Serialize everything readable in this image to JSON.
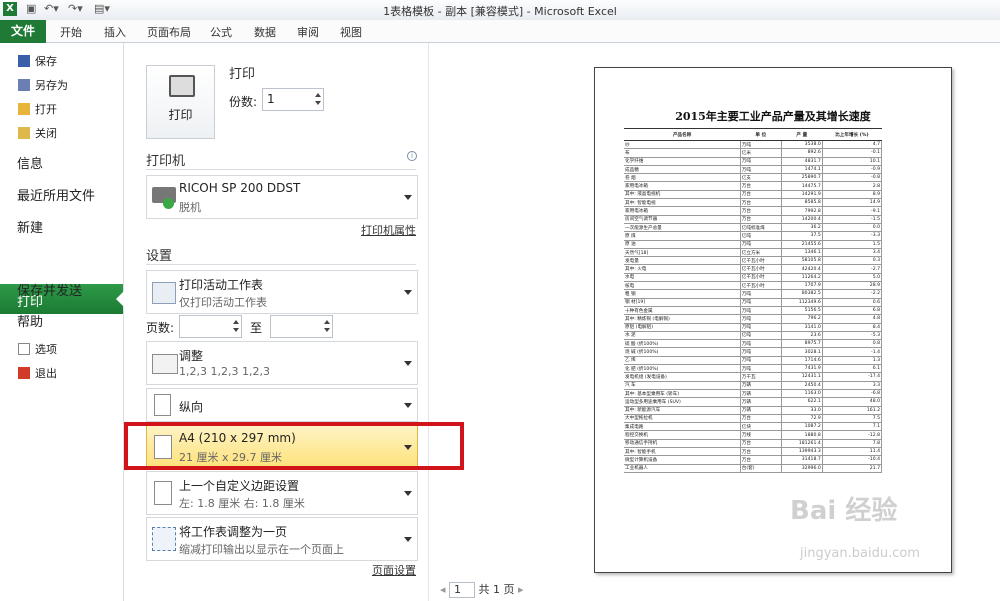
{
  "window": {
    "title": "1表格模板 - 副本  [兼容模式]  -  Microsoft Excel"
  },
  "ribbon": {
    "file_tab": "文件",
    "tabs": [
      "开始",
      "插入",
      "页面布局",
      "公式",
      "数据",
      "审阅",
      "视图"
    ]
  },
  "nav": {
    "save": "保存",
    "save_as": "另存为",
    "open": "打开",
    "close": "关闭",
    "info": "信息",
    "recent": "最近所用文件",
    "new": "新建",
    "print": "打印",
    "save_send": "保存并发送",
    "help": "帮助",
    "options": "选项",
    "exit": "退出"
  },
  "print": {
    "heading": "打印",
    "button_label": "打印",
    "copies_label": "份数:",
    "copies_value": "1"
  },
  "printer": {
    "heading": "打印机",
    "name": "RICOH SP 200 DDST",
    "status": "脱机",
    "properties_link": "打印机属性"
  },
  "settings": {
    "heading": "设置",
    "scope_title": "打印活动工作表",
    "scope_sub": "仅打印活动工作表",
    "pages_label": "页数:",
    "pages_to": "至",
    "collate_title": "调整",
    "collate_sub": "1,2,3    1,2,3    1,2,3",
    "orientation": "纵向",
    "paper_title": "A4 (210 x 297 mm)",
    "paper_sub": "21 厘米 x 29.7 厘米",
    "margins_title": "上一个自定义边距设置",
    "margins_sub": "左:  1.8 厘米    右:  1.8 厘米",
    "scaling_title": "将工作表调整为一页",
    "scaling_sub": "缩减打印输出以显示在一个页面上",
    "page_setup_link": "页面设置"
  },
  "preview": {
    "doc_title": "2015年主要工业产品产量及其增长速度",
    "headers": [
      "产品名称",
      "单 位",
      "产 量",
      "比上年增长 (%)"
    ],
    "rows": [
      [
        "纱",
        "万吨",
        "3538.0",
        "4.7"
      ],
      [
        "布",
        "亿米",
        "892.6",
        "-0.1"
      ],
      [
        "化学纤维",
        "万吨",
        "4831.7",
        "10.1"
      ],
      [
        "成品糖",
        "万吨",
        "1474.1",
        "-0.9"
      ],
      [
        "卷 烟",
        "亿支",
        "25890.7",
        "-0.8"
      ],
      [
        "家用电冰箱",
        "万台",
        "14475.7",
        "2.8"
      ],
      [
        "  其中: 液晶电视机",
        "万台",
        "14291.9",
        "8.9"
      ],
      [
        "其中: 智能电视",
        "万台",
        "8585.8",
        "14.9"
      ],
      [
        "家用电冰箱",
        "万台",
        "7992.8",
        "-9.1"
      ],
      [
        "房间空气调节器",
        "万台",
        "14200.4",
        "-1.5"
      ],
      [
        "一次能源生产总量",
        "亿吨标准煤",
        "36.2",
        "0.0"
      ],
      [
        "原 煤",
        "亿吨",
        "37.5",
        "-3.3"
      ],
      [
        "原 油",
        "万吨",
        "21455.6",
        "1.5"
      ],
      [
        "天然气[18]",
        "亿立方米",
        "1346.1",
        "3.4"
      ],
      [
        "发电量",
        "亿千瓦小时",
        "58105.8",
        "0.3"
      ],
      [
        "       其中: 火电",
        "亿千瓦小时",
        "42420.4",
        "-2.7"
      ],
      [
        "               水电",
        "亿千瓦小时",
        "11264.2",
        "5.0"
      ],
      [
        "               核电",
        "亿千瓦小时",
        "1707.9",
        "28.9"
      ],
      [
        "粗 钢",
        "万吨",
        "80382.5",
        "-2.2"
      ],
      [
        "钢 材[19]",
        "万吨",
        "112349.6",
        "0.6"
      ],
      [
        "十种有色金属",
        "万吨",
        "5156.5",
        "6.8"
      ],
      [
        "  其中: 精炼铜 (电解铜)",
        "万吨",
        "796.2",
        "4.8"
      ],
      [
        "原铝 (电解铝)",
        "万吨",
        "3141.0",
        "8.4"
      ],
      [
        "水 泥",
        "亿吨",
        "23.6",
        "-5.3"
      ],
      [
        "硫 酸 (折100%)",
        "万吨",
        "8975.7",
        "0.8"
      ],
      [
        "烧 碱 (折100%)",
        "万吨",
        "3028.1",
        "-1.4"
      ],
      [
        "乙 烯",
        "万吨",
        "1714.6",
        "1.3"
      ],
      [
        "化 肥 (折100%)",
        "万吨",
        "7431.9",
        "6.1"
      ],
      [
        "发电机组 (发电设备)",
        "万千瓦",
        "12431.1",
        "-17.4"
      ],
      [
        "汽 车",
        "万辆",
        "2450.4",
        "3.3"
      ],
      [
        "其中: 基本型乘用车 (轿车)",
        "万辆",
        "1163.0",
        "-6.8"
      ],
      [
        "      运动型多用途乘用车 (SUV)",
        "万辆",
        "622.1",
        "48.0"
      ],
      [
        "其中: 新能源汽车",
        "万辆",
        "33.0",
        "161.2"
      ],
      [
        "大中型拖拉机",
        "万台",
        "72.9",
        "7.5"
      ],
      [
        "集成电路",
        "亿块",
        "1087.2",
        "7.1"
      ],
      [
        "程控交换机",
        "万线",
        "1880.8",
        "-12.8"
      ],
      [
        "移动通信手持机",
        "万台",
        "181261.4",
        "7.8"
      ],
      [
        "  其中: 智能手机",
        "万台",
        "139943.3",
        "11.4"
      ],
      [
        "微型计算机设备",
        "万台",
        "31418.7",
        "-10.4"
      ],
      [
        "工业机器人",
        "台(套)",
        "32996.0",
        "21.7"
      ]
    ],
    "page_number": "1",
    "page_total": "共 1 页"
  },
  "watermark": {
    "brand": "Bai 经验",
    "url": "jingyan.baidu.com"
  },
  "colors": {
    "accent_green": "#1f7a35",
    "highlight_red": "#d0141a",
    "selected_yellow": "#fde27a"
  }
}
